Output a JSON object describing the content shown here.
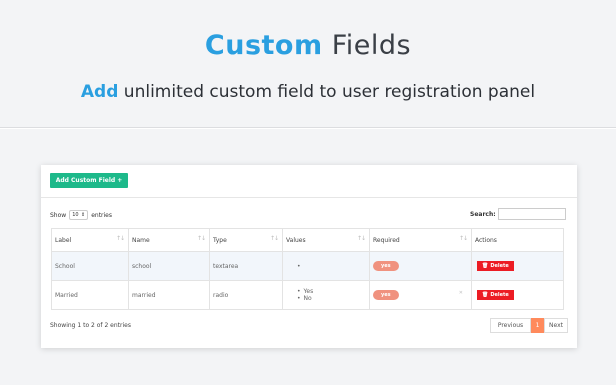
{
  "banner": {
    "title_accent": "Custom",
    "title_rest": "Fields",
    "subtitle_accent": "Add",
    "subtitle_rest": "unlimited custom field to user registration panel"
  },
  "toolbar": {
    "add_button_label": "Add Custom Field +"
  },
  "controls": {
    "show_label": "Show",
    "entries_value": "10",
    "entries_label": "entries",
    "search_label": "Search:"
  },
  "table": {
    "columns": [
      "Label",
      "Name",
      "Type",
      "Values",
      "Required",
      "Actions"
    ],
    "rows": [
      {
        "label": "School",
        "name": "school",
        "type": "textarea",
        "values": [
          ""
        ],
        "required": "yes",
        "action": "Delete"
      },
      {
        "label": "Married",
        "name": "married",
        "type": "radio",
        "values": [
          "Yes",
          "No"
        ],
        "required": "yes",
        "action": "Delete"
      }
    ]
  },
  "footer": {
    "info": "Showing 1 to 2 of 2 entries",
    "prev_label": "Previous",
    "current_page": "1",
    "next_label": "Next"
  },
  "colors": {
    "accent_blue": "#2a9fe0",
    "add_button_green": "#1db98a",
    "delete_red": "#ec1c24",
    "badge_salmon": "#f0927f",
    "page_active": "#ff8a5c"
  }
}
